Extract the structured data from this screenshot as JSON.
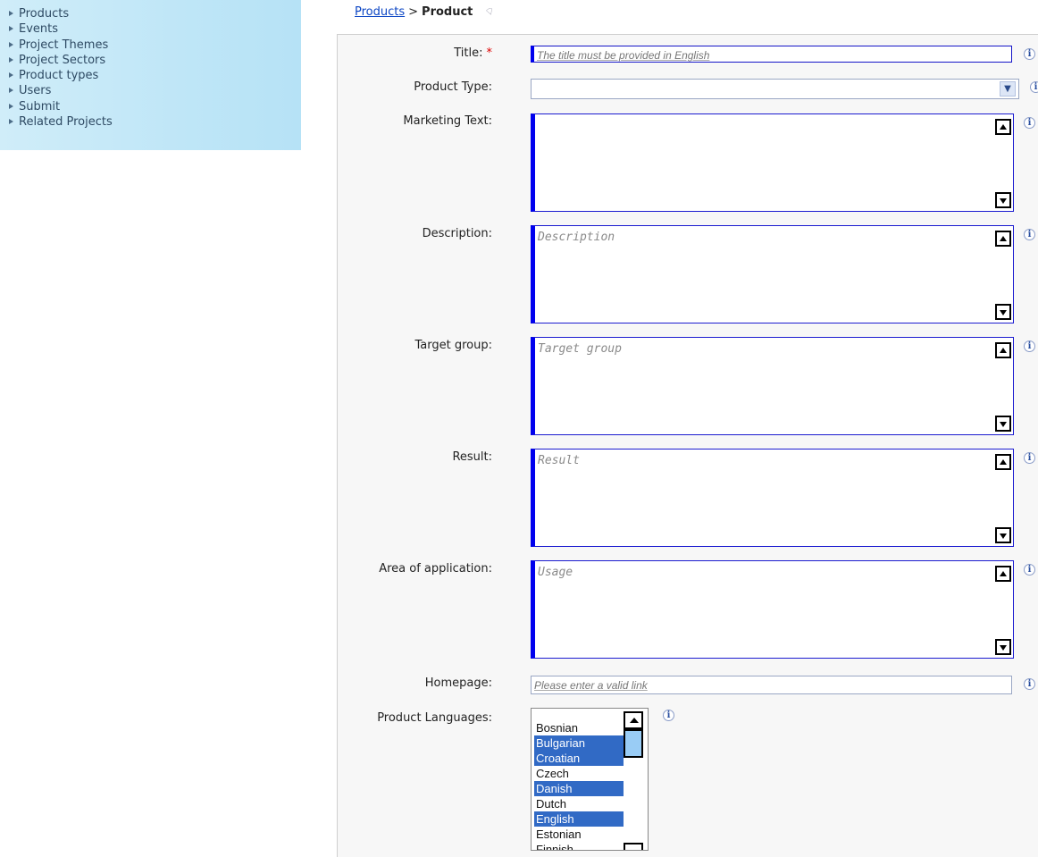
{
  "sidebar": {
    "items": [
      {
        "label": "Products"
      },
      {
        "label": "Events"
      },
      {
        "label": "Project Themes"
      },
      {
        "label": "Project Sectors"
      },
      {
        "label": "Product types"
      },
      {
        "label": "Users"
      },
      {
        "label": "Submit"
      },
      {
        "label": "Related Projects"
      }
    ]
  },
  "breadcrumb": {
    "link": "Products",
    "separator": ">",
    "current": "Product"
  },
  "form": {
    "title": {
      "label": "Title:",
      "required_mark": "*",
      "placeholder": "The title must be provided in English"
    },
    "product_type": {
      "label": "Product Type:",
      "value": ""
    },
    "marketing_text": {
      "label": "Marketing Text:",
      "placeholder": ""
    },
    "description": {
      "label": "Description:",
      "placeholder": "Description"
    },
    "target_group": {
      "label": "Target group:",
      "placeholder": "Target group"
    },
    "result": {
      "label": "Result:",
      "placeholder": "Result"
    },
    "area_of_application": {
      "label": "Area of application:",
      "placeholder": "Usage"
    },
    "homepage": {
      "label": "Homepage:",
      "placeholder": "Please enter a valid link"
    },
    "product_languages": {
      "label": "Product Languages:",
      "options": [
        {
          "name": "Bosnian",
          "selected": false
        },
        {
          "name": "Bulgarian",
          "selected": true
        },
        {
          "name": "Croatian",
          "selected": true
        },
        {
          "name": "Czech",
          "selected": false
        },
        {
          "name": "Danish",
          "selected": true
        },
        {
          "name": "Dutch",
          "selected": false
        },
        {
          "name": "English",
          "selected": true
        },
        {
          "name": "Estonian",
          "selected": false
        },
        {
          "name": "Finnish",
          "selected": false
        }
      ]
    }
  },
  "icons": {
    "info": "info-icon",
    "scroll_up": "arrow-up-icon",
    "scroll_down": "arrow-down-icon",
    "dropdown": "chevron-down-icon"
  },
  "colors": {
    "field_border": "#0000ee",
    "selected_option": "#316ac5",
    "sidebar_bg": "#c4e8f8",
    "link": "#0b45c4",
    "required": "#dd0000"
  }
}
